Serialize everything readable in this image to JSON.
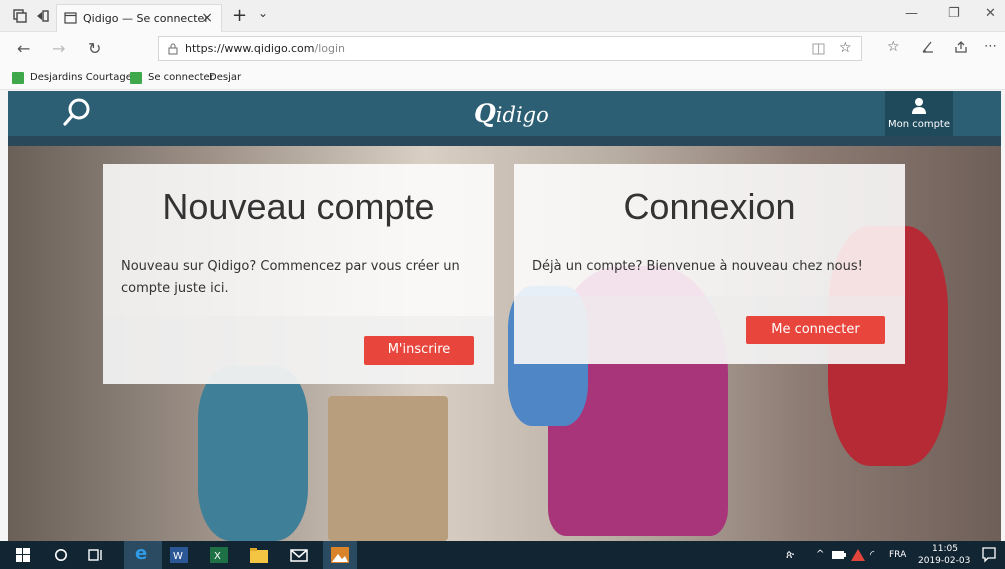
{
  "browser": {
    "tab_title": "Qidigo — Se connecter",
    "tab_close": "×",
    "new_tab": "+",
    "tabs_dropdown": "⌄",
    "url_host": "https://www.qidigo.com",
    "url_path": "/login",
    "favorites": [
      {
        "label": "Desjardins Courtage"
      },
      {
        "label": "Se connecter"
      },
      {
        "label": "Desjar"
      }
    ],
    "window_controls": {
      "minimize": "—",
      "restore": "❐",
      "close": "✕"
    }
  },
  "site": {
    "logo_q": "Q",
    "logo_rest": "idigo",
    "account_label": "Mon compte"
  },
  "cards": {
    "register": {
      "title": "Nouveau compte",
      "text": "Nouveau sur Qidigo? Commencez par vous créer un compte juste ici.",
      "button": "M'inscrire"
    },
    "login": {
      "title": "Connexion",
      "text": "Déjà un compte? Bienvenue à nouveau chez nous!",
      "button": "Me connecter"
    }
  },
  "taskbar": {
    "language": "FRA",
    "time": "11:05",
    "date": "2019-02-03"
  },
  "colors": {
    "header": "#2c5e74",
    "account": "#1f4a5c",
    "button": "#e8453c",
    "taskbar": "#122533"
  }
}
